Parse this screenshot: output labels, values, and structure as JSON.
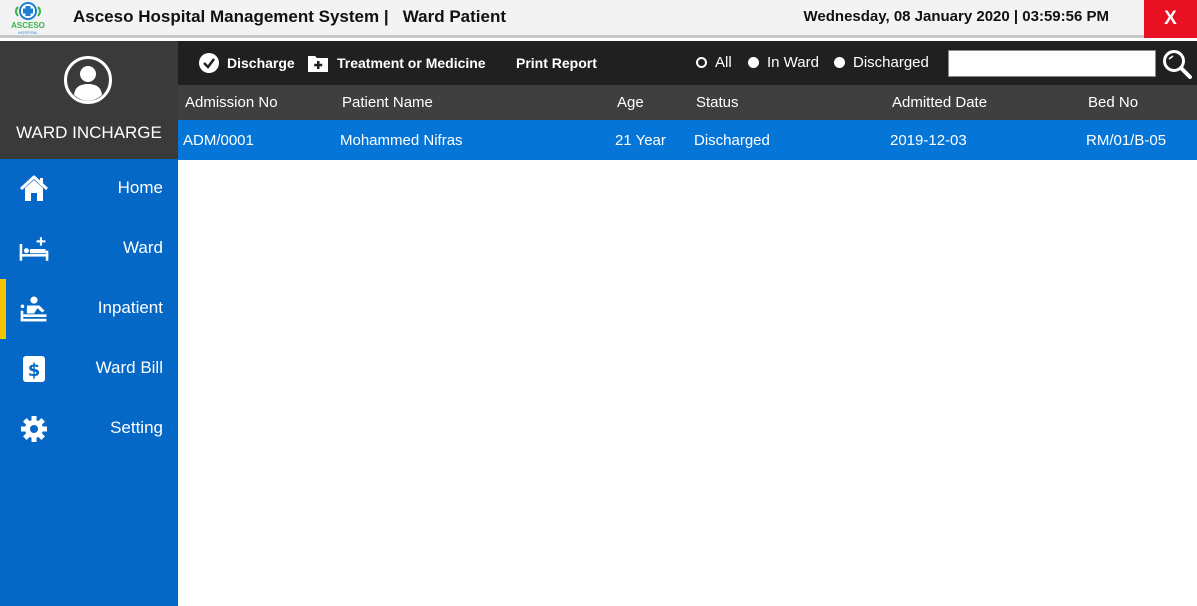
{
  "app": {
    "logo_text": "ASCESO",
    "logo_subtext": "HOSPITAL",
    "title": "Asceso Hospital Management System |   Ward Patient",
    "datetime": "Wednesday, 08 January 2020 | 03:59:56 PM",
    "close_label": "X"
  },
  "sidebar": {
    "role": "WARD INCHARGE",
    "items": [
      {
        "label": "Home",
        "icon": "home-icon"
      },
      {
        "label": "Ward",
        "icon": "bed-icon"
      },
      {
        "label": "Inpatient",
        "icon": "inpatient-icon",
        "active": true
      },
      {
        "label": "Ward Bill",
        "icon": "dollar-icon"
      },
      {
        "label": "Setting",
        "icon": "gear-icon"
      }
    ]
  },
  "toolbar": {
    "discharge_label": "Discharge",
    "treatment_label": "Treatment or Medicine",
    "print_label": "Print Report",
    "filters": [
      {
        "label": "All",
        "selected": false
      },
      {
        "label": "In Ward",
        "selected": true
      },
      {
        "label": "Discharged",
        "selected": true
      }
    ],
    "search_value": ""
  },
  "grid": {
    "columns": [
      "Admission No",
      "Patient Name",
      "Age",
      "Status",
      "Admitted Date",
      "Bed No"
    ],
    "rows": [
      [
        "ADM/0001",
        "Mohammed Nifras",
        "21 Year",
        "Discharged",
        "2019-12-03",
        "RM/01/B-05"
      ]
    ]
  },
  "colors": {
    "sidebar": "#0567c6",
    "active_indicator": "#f5c400",
    "selected_row": "#0575d8",
    "close_button": "#e81123"
  }
}
